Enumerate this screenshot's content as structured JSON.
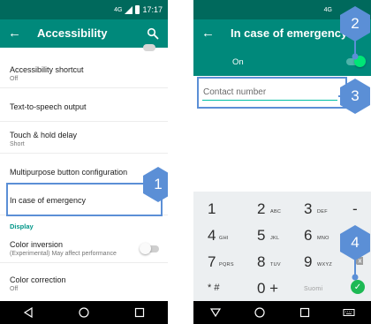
{
  "left_phone": {
    "status": {
      "network": "4G",
      "time": "17:17"
    },
    "appbar": {
      "title": "Accessibility",
      "back_icon": "back-arrow-icon",
      "search_icon": "search-icon"
    },
    "items": [
      {
        "title": "Accessibility shortcut",
        "subtitle": "Off"
      },
      {
        "title": "Text-to-speech output",
        "subtitle": ""
      },
      {
        "title": "Touch & hold delay",
        "subtitle": "Short"
      },
      {
        "title": "Multipurpose button configuration",
        "subtitle": ""
      },
      {
        "title": "In case of emergency",
        "subtitle": ""
      }
    ],
    "section_display": "Display",
    "color_inversion": {
      "title": "Color inversion",
      "subtitle": "(Experimental) May affect performance"
    },
    "color_correction": {
      "title": "Color correction",
      "subtitle": "Off"
    },
    "callout": "1"
  },
  "right_phone": {
    "status": {
      "network": "4G"
    },
    "appbar": {
      "title": "In case of emergency",
      "back_icon": "back-arrow-icon"
    },
    "on_row": {
      "label": "On"
    },
    "contact": {
      "placeholder": "Contact number"
    },
    "callouts": [
      "2",
      "3",
      "4"
    ],
    "keypad": {
      "rows": [
        [
          {
            "digit": "1",
            "letters": ""
          },
          {
            "digit": "2",
            "letters": "ABC"
          },
          {
            "digit": "3",
            "letters": "DEF"
          },
          {
            "digit": "-",
            "letters": ""
          }
        ],
        [
          {
            "digit": "4",
            "letters": "GHI"
          },
          {
            "digit": "5",
            "letters": "JKL"
          },
          {
            "digit": "6",
            "letters": "MNO"
          }
        ],
        [
          {
            "digit": "7",
            "letters": "PQRS"
          },
          {
            "digit": "8",
            "letters": "TUV"
          },
          {
            "digit": "9",
            "letters": "WXYZ"
          }
        ],
        [
          {
            "digit": "* #",
            "letters": ""
          },
          {
            "digit": "0 +",
            "letters": ""
          },
          {
            "digit": "",
            "letters": "Suomi"
          }
        ]
      ]
    }
  },
  "colors": {
    "statusbar": "#00695c",
    "appbar": "#00897b",
    "accent": "#009688",
    "callout": "#5b8fd6",
    "toggle_on": "#00e676"
  }
}
